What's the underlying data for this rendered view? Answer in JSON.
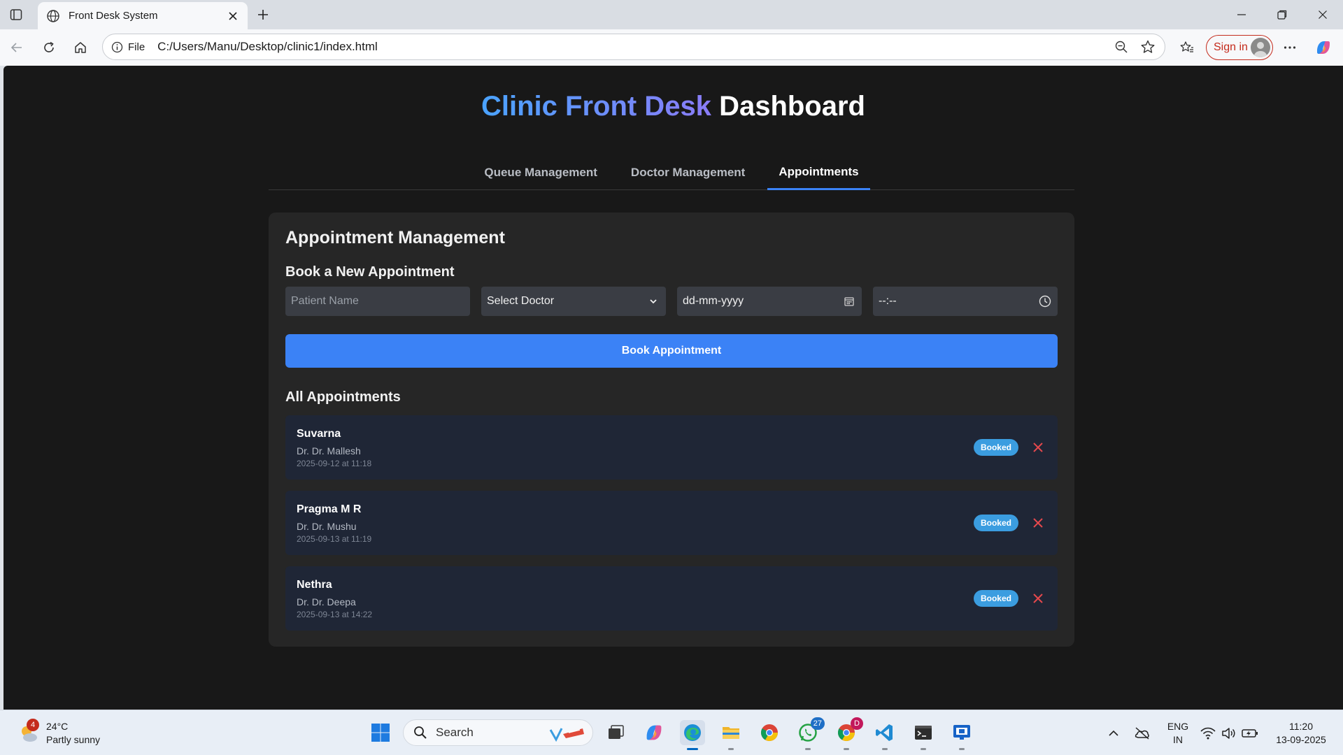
{
  "browser": {
    "tab_title": "Front Desk System",
    "address_scheme": "File",
    "address_url": "C:/Users/Manu/Desktop/clinic1/index.html",
    "signin_label": "Sign in"
  },
  "header": {
    "title_accent": "Clinic Front Desk",
    "title_rest": "Dashboard",
    "accent_colors": [
      "#4aa3ff",
      "#8a7cf7"
    ]
  },
  "nav": {
    "tabs": [
      {
        "label": "Queue Management",
        "active": false
      },
      {
        "label": "Doctor Management",
        "active": false
      },
      {
        "label": "Appointments",
        "active": true
      }
    ]
  },
  "appointments_card": {
    "heading": "Appointment Management",
    "book_heading": "Book a New Appointment",
    "form": {
      "patient_placeholder": "Patient Name",
      "doctor_select": "Select Doctor",
      "date_value": "dd-mm-yyyy",
      "time_value": "--:--"
    },
    "book_button": "Book Appointment",
    "list_heading": "All Appointments",
    "items": [
      {
        "patient": "Suvarna",
        "doctor": "Dr. Dr. Mallesh",
        "when": "2025-09-12 at 11:18",
        "status": "Booked"
      },
      {
        "patient": "Pragma M R",
        "doctor": "Dr. Dr. Mushu",
        "when": "2025-09-13 at 11:19",
        "status": "Booked"
      },
      {
        "patient": "Nethra",
        "doctor": "Dr. Dr. Deepa",
        "when": "2025-09-13 at 14:22",
        "status": "Booked"
      }
    ],
    "colors": {
      "primary": "#3b82f6",
      "badge": "#3b9de0",
      "cancel": "#e5484d"
    }
  },
  "taskbar": {
    "weather_temp": "24°C",
    "weather_desc": "Partly sunny",
    "weather_badge": "4",
    "search_label": "Search",
    "whatsapp_badge": "27",
    "chrome_badge": "D",
    "lang_top": "ENG",
    "lang_bottom": "IN",
    "time": "11:20",
    "date": "13-09-2025"
  }
}
